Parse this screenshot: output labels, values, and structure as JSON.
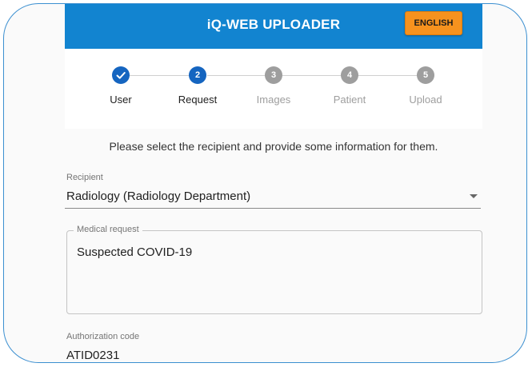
{
  "header": {
    "title": "iQ-WEB UPLOADER",
    "language_button": "ENGLISH"
  },
  "stepper": {
    "steps": [
      {
        "number": "",
        "label": "User",
        "state": "completed"
      },
      {
        "number": "2",
        "label": "Request",
        "state": "active"
      },
      {
        "number": "3",
        "label": "Images",
        "state": "inactive"
      },
      {
        "number": "4",
        "label": "Patient",
        "state": "inactive"
      },
      {
        "number": "5",
        "label": "Upload",
        "state": "inactive"
      }
    ]
  },
  "form": {
    "instructions": "Please select the recipient and provide some information for them.",
    "recipient": {
      "label": "Recipient",
      "value": "Radiology (Radiology Department)"
    },
    "medical_request": {
      "label": "Medical request",
      "value": "Suspected COVID-19"
    },
    "authorization_code": {
      "label": "Authorization code",
      "value": "ATID0231"
    }
  },
  "colors": {
    "header_bg": "#1284d0",
    "language_button_bg": "#f6921e",
    "step_active": "#1565c0",
    "step_inactive": "#9e9e9e",
    "frame_border": "#3b8fd0"
  }
}
